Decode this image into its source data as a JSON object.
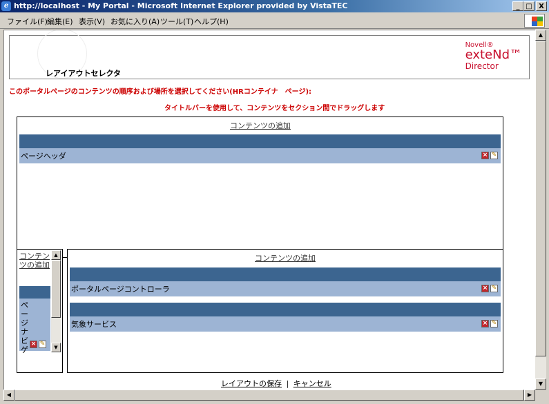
{
  "window": {
    "title": "http://localhost - My Portal - Microsoft Internet Explorer provided by VistaTEC",
    "min_label": "_",
    "max_label": "□",
    "close_label": "X"
  },
  "menu": {
    "items": [
      "ファイル(F)",
      "編集(E)",
      "表示(V)",
      "お気に入り(A)",
      "ツール(T)",
      "ヘルプ(H)"
    ]
  },
  "banner": {
    "title": "レアイアウトセレクタ",
    "logo": {
      "line1": "Novell®",
      "line2": "exteNd™",
      "line3": "Director"
    }
  },
  "instructions": {
    "line1": "このポータルページのコンテンツの順序および場所を選択してください(HRコンテイナ　ページ):",
    "line2": "タイトルバーを使用して、コンテンツをセクション間でドラッグします"
  },
  "top_section": {
    "add_content": "コンテンツの追加",
    "portlets": [
      {
        "title": "ページヘッダ"
      }
    ]
  },
  "left_section": {
    "add_content": "コンテンツの追加",
    "portlets": [
      {
        "title": "ページナビゲ"
      }
    ]
  },
  "right_section": {
    "add_content": "コンテンツの追加",
    "portlets": [
      {
        "title": "ポータルページコントローラ"
      },
      {
        "title": "気象サービス"
      }
    ]
  },
  "footer": {
    "save": "レイアウトの保存",
    "separator": "|",
    "cancel": "キャンセル"
  }
}
